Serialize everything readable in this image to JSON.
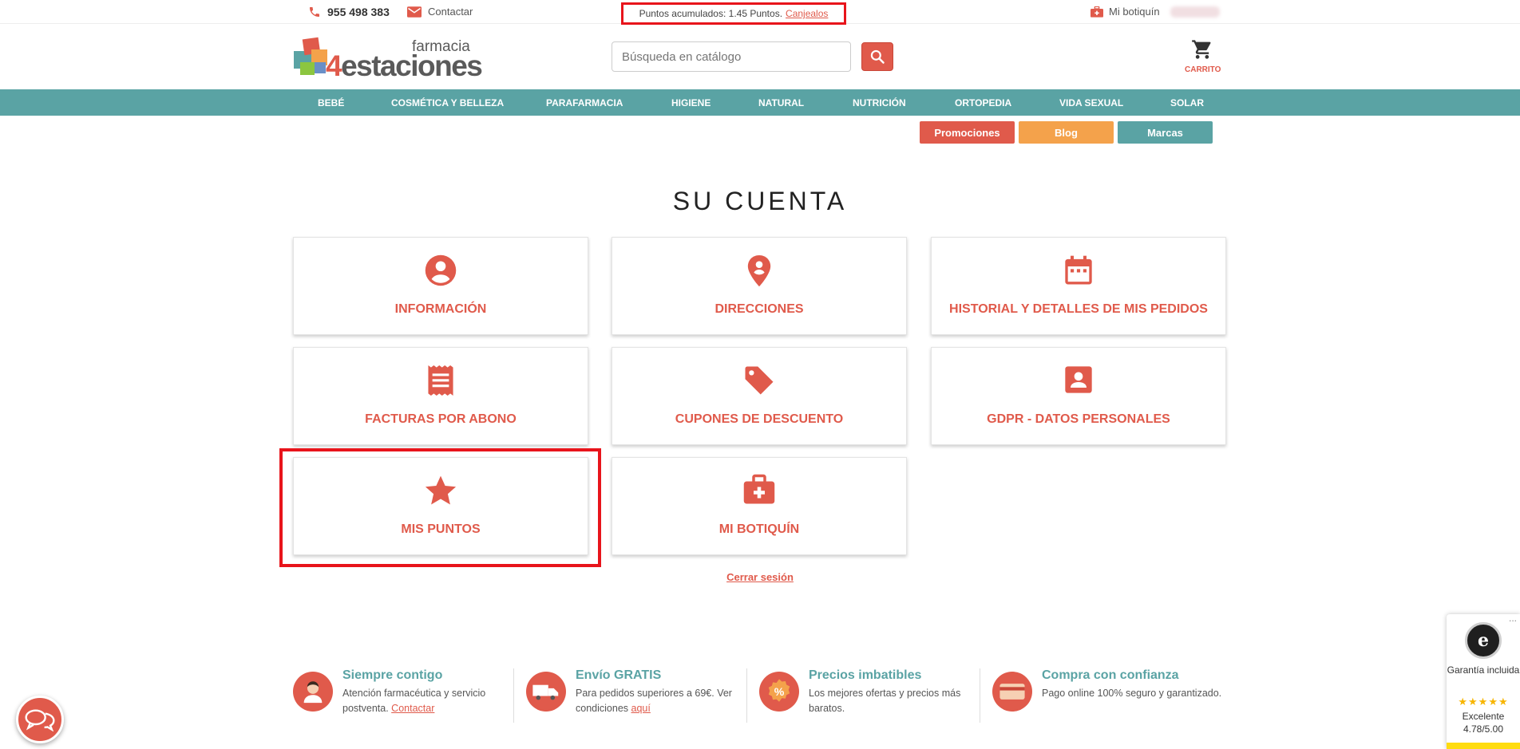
{
  "topbar": {
    "phone": "955 498 383",
    "contact": "Contactar",
    "points_text": "Puntos acumulados: 1.45 Puntos.",
    "points_link": "Canjealos",
    "botiquin": "Mi botiquín"
  },
  "header": {
    "logo_small": "farmacia",
    "logo_num": "4",
    "logo_word": "estaciones",
    "search_placeholder": "Búsqueda en catálogo",
    "cart_label": "CARRITO"
  },
  "nav": {
    "items": [
      "BEBÉ",
      "COSMÉTICA Y BELLEZA",
      "PARAFARMACIA",
      "HIGIENE",
      "NATURAL",
      "NUTRICIÓN",
      "ORTOPEDIA",
      "VIDA SEXUAL",
      "SOLAR"
    ]
  },
  "pills": {
    "promo": "Promociones",
    "blog": "Blog",
    "marcas": "Marcas"
  },
  "page": {
    "title": "SU CUENTA",
    "logout": "Cerrar sesión"
  },
  "cards": [
    {
      "label": "INFORMACIÓN",
      "icon": "account-circle-icon"
    },
    {
      "label": "DIRECCIONES",
      "icon": "location-pin-icon"
    },
    {
      "label": "HISTORIAL Y DETALLES DE MIS PEDIDOS",
      "icon": "calendar-icon"
    },
    {
      "label": "FACTURAS POR ABONO",
      "icon": "receipt-icon"
    },
    {
      "label": "CUPONES DE DESCUENTO",
      "icon": "tag-icon"
    },
    {
      "label": "GDPR - DATOS PERSONALES",
      "icon": "contact-id-icon"
    },
    {
      "label": "MIS PUNTOS",
      "icon": "star-icon"
    },
    {
      "label": "MI BOTIQUÍN",
      "icon": "medkit-icon"
    }
  ],
  "features": [
    {
      "title": "Siempre contigo",
      "desc": "Atención farmacéutica y servicio postventa.",
      "link": "Contactar"
    },
    {
      "title": "Envío GRATIS",
      "desc": "Para pedidos superiores a 69€. Ver condiciones",
      "link": "aquí"
    },
    {
      "title": "Precios imbatibles",
      "desc": "Los mejores ofertas y precios más baratos.",
      "link": ""
    },
    {
      "title": "Compra con confianza",
      "desc": "Pago online 100% seguro y garantizado.",
      "link": ""
    }
  ],
  "trusted": {
    "seal": "e",
    "guarantee": "Garantía incluida",
    "stars": "★★★★★",
    "rating_label": "Excelente",
    "rating": "4.78/5.00",
    "menu": "..."
  },
  "colors": {
    "accent": "#e05a4b",
    "teal": "#5aa3a4",
    "orange": "#f4a24b",
    "highlight": "#e8141b"
  }
}
